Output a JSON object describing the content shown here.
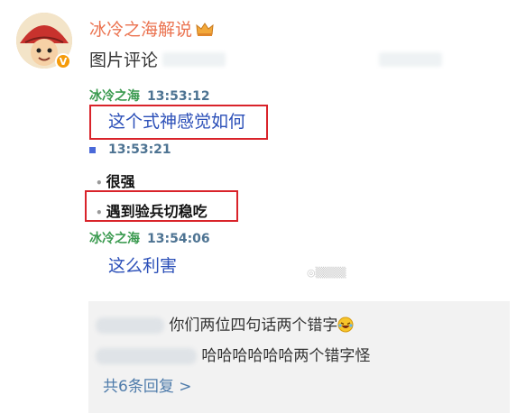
{
  "post": {
    "username": "冰冷之海解说",
    "text": "图片评论",
    "verified_badge": "V"
  },
  "chat": {
    "m1_sender": "冰冷之海",
    "m1_time": "13:53:12",
    "m1_text": "这个式神感觉如何",
    "m2_time": "13:53:21",
    "m3_text": "很强",
    "m4_text": "遇到验兵切稳吃",
    "m5_sender": "冰冷之海",
    "m5_time": "13:54:06",
    "m5_text": "这么利害"
  },
  "replies": {
    "r1_text": "你们两位四句话两个错字",
    "r2_text": "哈哈哈哈哈哈两个错字怪",
    "more_label": "共6条回复 >"
  },
  "icons": {
    "crown": "crown-icon",
    "verified": "verified-badge-icon",
    "laugh": "laugh-cry-emoji-icon"
  },
  "colors": {
    "username": "#eb7350",
    "highlight_box": "#d9232a",
    "link": "#4f7cab"
  }
}
